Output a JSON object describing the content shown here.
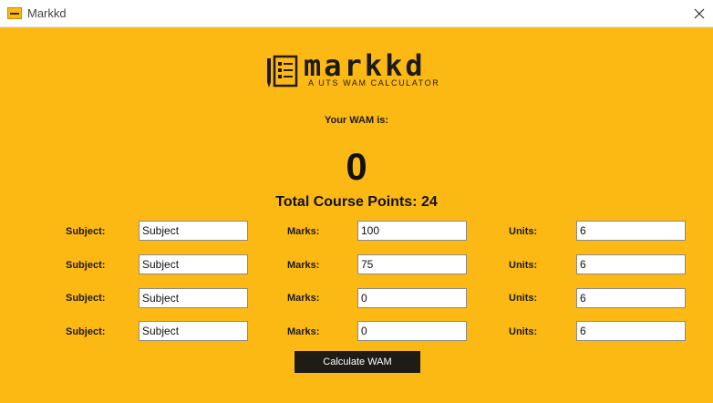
{
  "window": {
    "title": "Markkd",
    "accent_color": "#FDB913",
    "close_icon": "close-icon"
  },
  "logo": {
    "brand": "markkd",
    "tagline": "A UTS WAM CALCULATOR",
    "icon": "notepad-pencil-icon"
  },
  "wam": {
    "label": "Your WAM is:",
    "value": "0"
  },
  "total": {
    "label": "Total Course Points:",
    "value": "24"
  },
  "rows": [
    {
      "subject_label": "Subject:",
      "subject": "Subject",
      "marks_label": "Marks:",
      "marks": "100",
      "units_label": "Units:",
      "units": "6"
    },
    {
      "subject_label": "Subject:",
      "subject": "Subject",
      "marks_label": "Marks:",
      "marks": "75",
      "units_label": "Units:",
      "units": "6"
    },
    {
      "subject_label": "Subject:",
      "subject": "Subject",
      "marks_label": "Marks:",
      "marks": "0",
      "units_label": "Units:",
      "units": "6"
    },
    {
      "subject_label": "Subject:",
      "subject": "Subject",
      "marks_label": "Marks:",
      "marks": "0",
      "units_label": "Units:",
      "units": "6"
    }
  ],
  "actions": {
    "calculate_label": "Calculate WAM"
  }
}
